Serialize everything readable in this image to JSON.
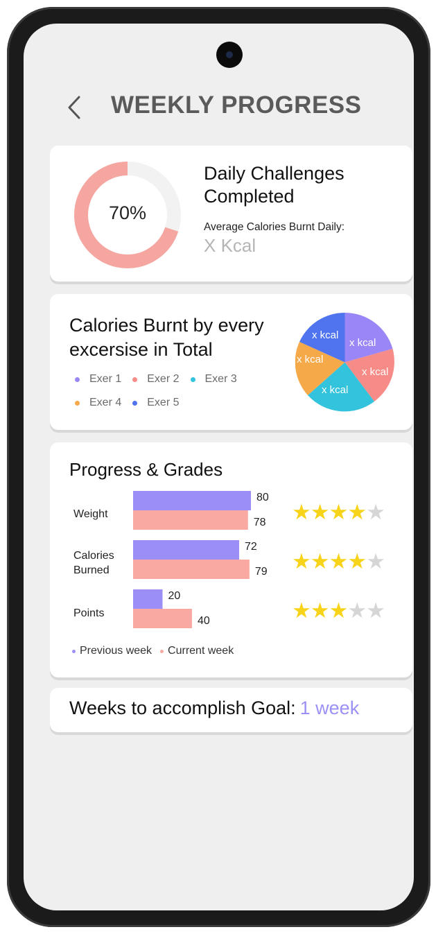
{
  "header": {
    "title": "WEEKLY PROGRESS",
    "back_icon": "chevron-left-icon"
  },
  "challenges": {
    "percent": 70,
    "percent_label": "70%",
    "title": "Daily Challenges Completed",
    "avg_label": "Average Calories Burnt Daily:",
    "avg_value": "X Kcal",
    "ring_color": "#f6a6a1",
    "ring_track_color": "#f2f2f2"
  },
  "calories": {
    "title": "Calories Burnt by every excersise in Total",
    "legend": [
      {
        "label": "Exer 1",
        "color": "#9a86f7"
      },
      {
        "label": "Exer 2",
        "color": "#f68b87"
      },
      {
        "label": "Exer 3",
        "color": "#33c3dc"
      },
      {
        "label": "Exer 4",
        "color": "#f6a948"
      },
      {
        "label": "Exer 5",
        "color": "#4f74ee"
      }
    ],
    "pie_labels": [
      "x kcal",
      "x kcal",
      "x kcal",
      "x kcal",
      "x kcal"
    ]
  },
  "progress": {
    "title": "Progress & Grades",
    "rows": [
      {
        "label": "Weight",
        "previous": 80,
        "current": 78,
        "stars": 4
      },
      {
        "label": "Calories\nBurned",
        "previous": 72,
        "current": 79,
        "stars": 4
      },
      {
        "label": "Points",
        "previous": 20,
        "current": 40,
        "stars": 3
      }
    ],
    "max_stars": 5,
    "legend_previous": "Previous week",
    "legend_current": "Current week",
    "previous_color": "#9b8ff7",
    "current_color": "#f9a8a2"
  },
  "goal": {
    "label": "Weeks to accomplish Goal:",
    "value": "1 week"
  }
}
